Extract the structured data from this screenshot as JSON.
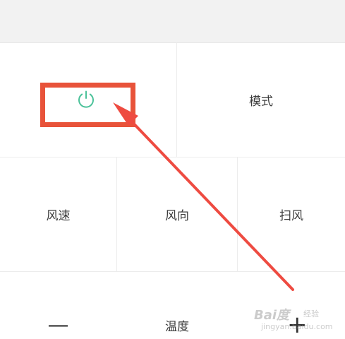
{
  "controls": {
    "power_icon": "power-icon",
    "mode_label": "模式",
    "fan_speed_label": "风速",
    "wind_direction_label": "风向",
    "swing_label": "扫风",
    "temperature_label": "温度",
    "decrease_label": "—",
    "increase_label": "+"
  },
  "annotation": {
    "highlight_color": "#e8533a",
    "power_icon_color": "#4cc29a"
  },
  "watermark": {
    "logo_text": "Bai度",
    "sub_text": "经验",
    "url_text": "jingyan.baidu.com"
  }
}
